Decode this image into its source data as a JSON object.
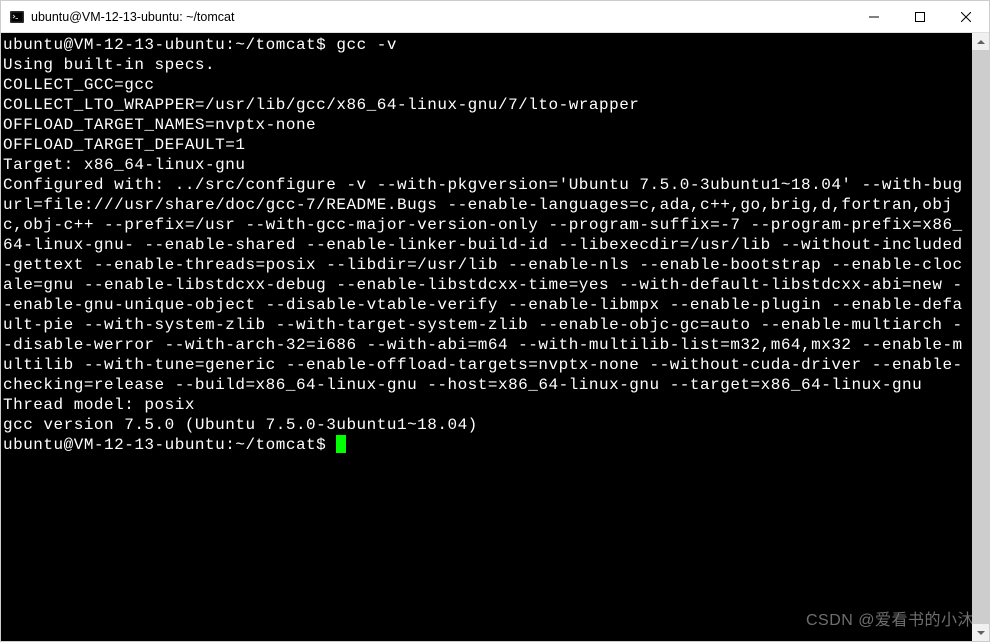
{
  "window": {
    "title": "ubuntu@VM-12-13-ubuntu: ~/tomcat"
  },
  "terminal": {
    "prompt1": "ubuntu@VM-12-13-ubuntu:~/tomcat$ ",
    "command1": "gcc -v",
    "line_using": "Using built-in specs.",
    "line_collect_gcc": "COLLECT_GCC=gcc",
    "line_collect_lto": "COLLECT_LTO_WRAPPER=/usr/lib/gcc/x86_64-linux-gnu/7/lto-wrapper",
    "line_offload_names": "OFFLOAD_TARGET_NAMES=nvptx-none",
    "line_offload_default": "OFFLOAD_TARGET_DEFAULT=1",
    "line_target": "Target: x86_64-linux-gnu",
    "line_configured": "Configured with: ../src/configure -v --with-pkgversion='Ubuntu 7.5.0-3ubuntu1~18.04' --with-bugurl=file:///usr/share/doc/gcc-7/README.Bugs --enable-languages=c,ada,c++,go,brig,d,fortran,objc,obj-c++ --prefix=/usr --with-gcc-major-version-only --program-suffix=-7 --program-prefix=x86_64-linux-gnu- --enable-shared --enable-linker-build-id --libexecdir=/usr/lib --without-included-gettext --enable-threads=posix --libdir=/usr/lib --enable-nls --enable-bootstrap --enable-clocale=gnu --enable-libstdcxx-debug --enable-libstdcxx-time=yes --with-default-libstdcxx-abi=new --enable-gnu-unique-object --disable-vtable-verify --enable-libmpx --enable-plugin --enable-default-pie --with-system-zlib --with-target-system-zlib --enable-objc-gc=auto --enable-multiarch --disable-werror --with-arch-32=i686 --with-abi=m64 --with-multilib-list=m32,m64,mx32 --enable-multilib --with-tune=generic --enable-offload-targets=nvptx-none --without-cuda-driver --enable-checking=release --build=x86_64-linux-gnu --host=x86_64-linux-gnu --target=x86_64-linux-gnu",
    "line_thread_model": "Thread model: posix",
    "line_gcc_version": "gcc version 7.5.0 (Ubuntu 7.5.0-3ubuntu1~18.04)",
    "prompt2": "ubuntu@VM-12-13-ubuntu:~/tomcat$ "
  },
  "watermark": "CSDN @爱看书的小沐"
}
